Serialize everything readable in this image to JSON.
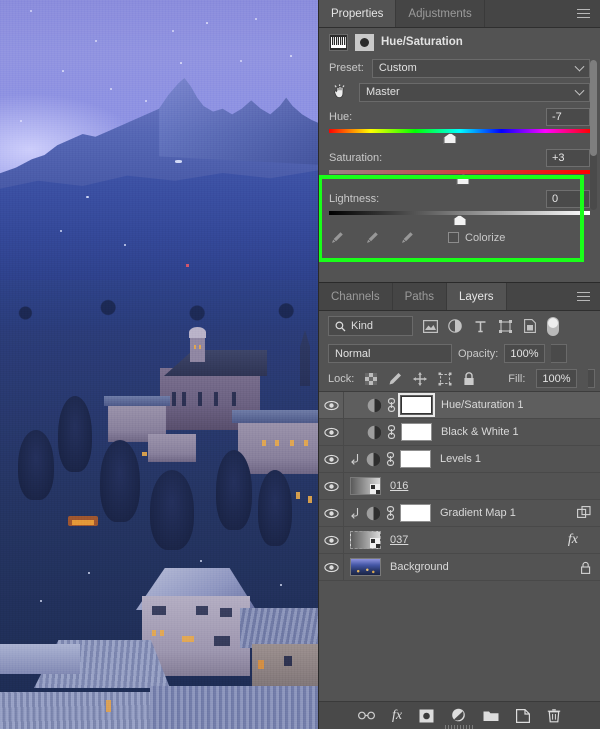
{
  "properties_panel": {
    "tabs": [
      {
        "label": "Properties",
        "active": true
      },
      {
        "label": "Adjustments",
        "active": false
      }
    ],
    "menu_icon": "hamburger-menu-icon",
    "adjustment_title": "Hue/Saturation",
    "adjustment_icon": "hue-saturation-icon",
    "mask_icon": "layer-mask-icon",
    "preset_label": "Preset:",
    "preset_value": "Custom",
    "targeted_adjust_icon": "on-image-adjustment-hand-icon",
    "channel_value": "Master",
    "sliders": [
      {
        "label": "Hue:",
        "value": "-7",
        "thumb_pct": 46.5,
        "track": "hue"
      },
      {
        "label": "Saturation:",
        "value": "+3",
        "thumb_pct": 51.5,
        "track": "saturation"
      },
      {
        "label": "Lightness:",
        "value": "0",
        "thumb_pct": 50,
        "track": "lightness"
      }
    ],
    "eyedroppers": [
      "eyedropper-icon",
      "eyedropper-add-icon",
      "eyedropper-subtract-icon"
    ],
    "colorize_label": "Colorize",
    "colorize_checked": false,
    "footer_buttons": [
      {
        "name": "clip-to-layer-button",
        "icon": "clip-to-layer-icon"
      },
      {
        "name": "view-previous-state-button",
        "icon": "previous-state-eye-icon"
      },
      {
        "name": "reset-button",
        "icon": "reset-arrow-icon"
      },
      {
        "name": "toggle-visibility-button",
        "icon": "eye-icon",
        "active": true
      },
      {
        "name": "delete-adjustment-button",
        "icon": "trash-icon"
      }
    ],
    "highlight_color": "#19ff19"
  },
  "layers_panel": {
    "tabs": [
      {
        "label": "Channels",
        "active": false
      },
      {
        "label": "Paths",
        "active": false
      },
      {
        "label": "Layers",
        "active": true
      }
    ],
    "menu_icon": "hamburger-menu-icon",
    "filter": {
      "search_icon": "search-icon",
      "kind_label": "Kind",
      "type_filters": [
        "filter-pixel-layers-icon",
        "filter-adjustment-layers-icon",
        "filter-type-layers-icon",
        "filter-shape-layers-icon",
        "filter-smart-object-icon"
      ],
      "toggle_name": "filter-enable-toggle"
    },
    "blend_mode": "Normal",
    "opacity_label": "Opacity:",
    "opacity_value": "100%",
    "lock_label": "Lock:",
    "lock_icons": [
      "lock-transparent-pixels-icon",
      "lock-image-pixels-icon",
      "lock-position-icon",
      "lock-artboard-nesting-icon",
      "lock-all-icon"
    ],
    "fill_label": "Fill:",
    "fill_value": "100%",
    "layers": [
      {
        "name": "Hue/Saturation 1",
        "visible": true,
        "selected": true,
        "thumb": "adjustment",
        "mask": "white",
        "mask_active": true,
        "linked": true,
        "clipped": false,
        "right_icon": ""
      },
      {
        "name": "Black & White 1",
        "visible": true,
        "selected": false,
        "thumb": "adjustment",
        "mask": "white",
        "mask_active": false,
        "linked": true,
        "clipped": false,
        "right_icon": ""
      },
      {
        "name": "Levels 1",
        "visible": true,
        "selected": false,
        "thumb": "adjustment",
        "mask": "white",
        "mask_active": false,
        "linked": true,
        "clipped": true,
        "right_icon": ""
      },
      {
        "name": "016",
        "visible": true,
        "selected": false,
        "thumb": "smart-gradient",
        "mask": "none",
        "mask_active": false,
        "linked": false,
        "clipped": false,
        "underline": true,
        "right_icon": ""
      },
      {
        "name": "Gradient Map 1",
        "visible": true,
        "selected": false,
        "thumb": "adjustment",
        "mask": "white",
        "mask_active": false,
        "linked": true,
        "clipped": true,
        "right_icon": "duplicate-frames-icon"
      },
      {
        "name": "037",
        "visible": true,
        "selected": false,
        "thumb": "smart-dashed",
        "mask": "none",
        "mask_active": false,
        "linked": false,
        "clipped": false,
        "underline": true,
        "right_icon": "fx-icon"
      },
      {
        "name": "Background",
        "visible": true,
        "selected": false,
        "thumb": "photo",
        "mask": "none",
        "mask_active": false,
        "linked": false,
        "clipped": false,
        "right_icon": "lock-icon"
      }
    ],
    "footer_buttons": [
      {
        "name": "link-layers-button",
        "icon": "link-icon"
      },
      {
        "name": "layer-style-button",
        "icon": "fx-icon"
      },
      {
        "name": "add-layer-mask-button",
        "icon": "mask-icon"
      },
      {
        "name": "new-adjustment-layer-button",
        "icon": "half-circle-icon"
      },
      {
        "name": "new-group-button",
        "icon": "folder-icon"
      },
      {
        "name": "new-layer-button",
        "icon": "new-layer-icon"
      },
      {
        "name": "delete-layer-button",
        "icon": "trash-icon"
      }
    ]
  },
  "canvas": {
    "name": "image-canvas",
    "description": "Blue-toned winter alpine village with mountain peak"
  }
}
